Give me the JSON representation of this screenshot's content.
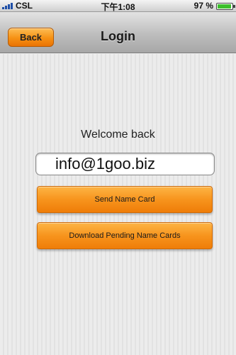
{
  "status_bar": {
    "carrier": "CSL",
    "time": "下午1:08",
    "battery_percent": "97 %"
  },
  "nav_bar": {
    "back_label": "Back",
    "title": "Login"
  },
  "main": {
    "welcome_text": "Welcome back",
    "email_value": "info@1goo.biz",
    "send_button_label": "Send Name Card",
    "download_button_label": "Download Pending Name Cards"
  },
  "colors": {
    "accent_orange": "#f7941d",
    "nav_gray": "#bdbdbd",
    "signal_blue": "#1f4fa8",
    "battery_green": "#3cbf2c"
  }
}
